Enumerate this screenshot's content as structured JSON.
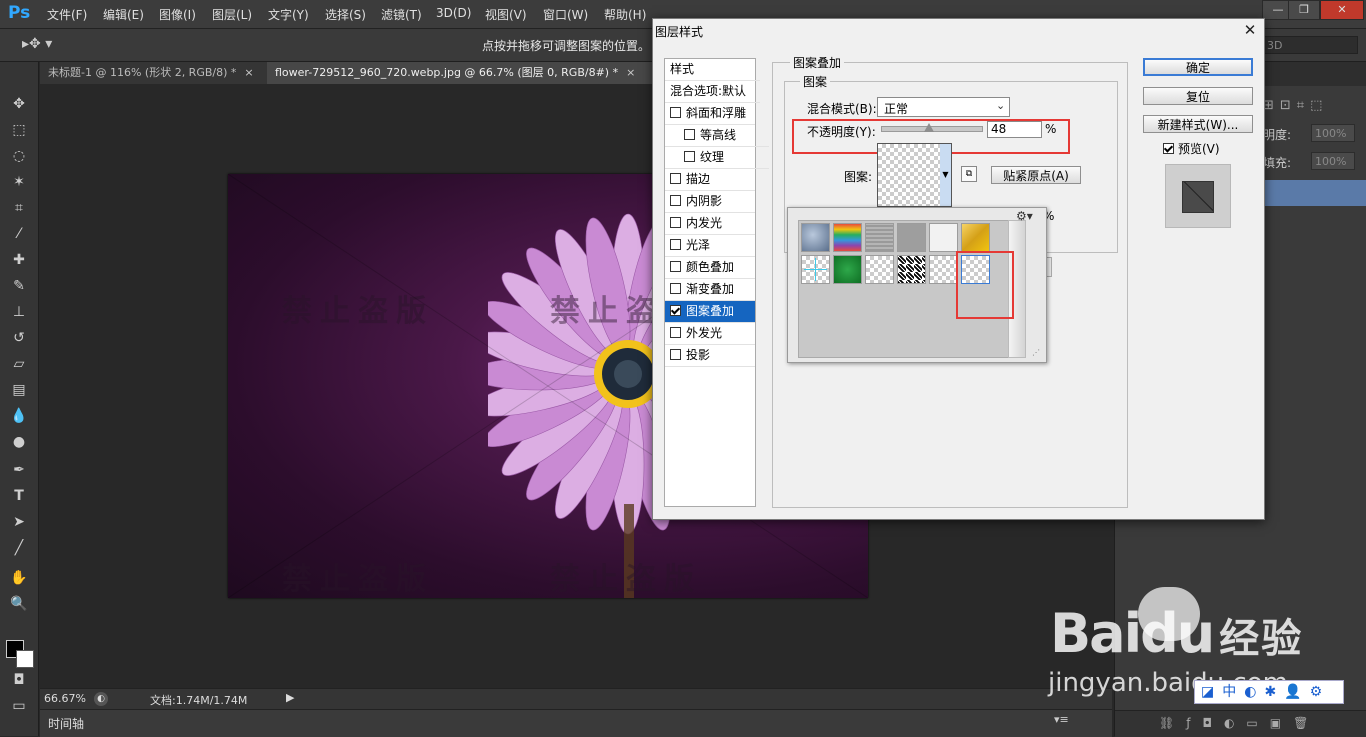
{
  "app": {
    "logo": "Ps",
    "menus": [
      "文件(F)",
      "编辑(E)",
      "图像(I)",
      "图层(L)",
      "文字(Y)",
      "选择(S)",
      "滤镜(T)",
      "3D(D)",
      "视图(V)",
      "窗口(W)",
      "帮助(H)"
    ],
    "window_buttons": [
      "—",
      "❐",
      "✕"
    ]
  },
  "options_bar": {
    "hint": "点按并拖移可调整图案的位置。",
    "right_field": "3D"
  },
  "tabs": [
    {
      "label": "未标题-1 @ 116% (形状 2, RGB/8) *"
    },
    {
      "label": "flower-729512_960_720.webp.jpg @ 66.7% (图层 0, RGB/8#) *"
    }
  ],
  "canvas": {
    "watermark": "禁止盗版"
  },
  "status": {
    "zoom": "66.67%",
    "doc": "文档:1.74M/1.74M",
    "timeline": "时间轴"
  },
  "right_panel": {
    "opacity_label": "明度:",
    "opacity_value": "100%",
    "fill_label": "填充:",
    "fill_value": "100%"
  },
  "dialog": {
    "title": "图层样式",
    "style_list_header": "样式",
    "style_list": [
      {
        "label": "混合选项:默认",
        "checkbox": false
      },
      {
        "label": "斜面和浮雕",
        "checkbox": true,
        "checked": false
      },
      {
        "label": "等高线",
        "checkbox": true,
        "checked": false,
        "indent": true
      },
      {
        "label": "纹理",
        "checkbox": true,
        "checked": false,
        "indent": true
      },
      {
        "label": "描边",
        "checkbox": true,
        "checked": false
      },
      {
        "label": "内阴影",
        "checkbox": true,
        "checked": false
      },
      {
        "label": "内发光",
        "checkbox": true,
        "checked": false
      },
      {
        "label": "光泽",
        "checkbox": true,
        "checked": false
      },
      {
        "label": "颜色叠加",
        "checkbox": true,
        "checked": false
      },
      {
        "label": "渐变叠加",
        "checkbox": true,
        "checked": false
      },
      {
        "label": "图案叠加",
        "checkbox": true,
        "checked": true,
        "selected": true
      },
      {
        "label": "外发光",
        "checkbox": true,
        "checked": false
      },
      {
        "label": "投影",
        "checkbox": true,
        "checked": false
      }
    ],
    "group_title": "图案叠加",
    "subgroup_title": "图案",
    "blend_mode_label": "混合模式(B):",
    "blend_mode_value": "正常",
    "opacity_label": "不透明度(Y):",
    "opacity_value": "48",
    "opacity_fraction": 0.48,
    "percent": "%",
    "pattern_label": "图案:",
    "snap_button": "贴紧原点(A)",
    "ok_button": "确定",
    "reset_button": "复位",
    "new_style_button": "新建样式(W)...",
    "preview_label": "预览(V)",
    "preview_checked": true
  },
  "branding": {
    "baidu": "Bai",
    "du": "du",
    "jingyan_cn": "经验",
    "jingyan_url": "jingyan.baidu.com",
    "ime_label": "中"
  }
}
